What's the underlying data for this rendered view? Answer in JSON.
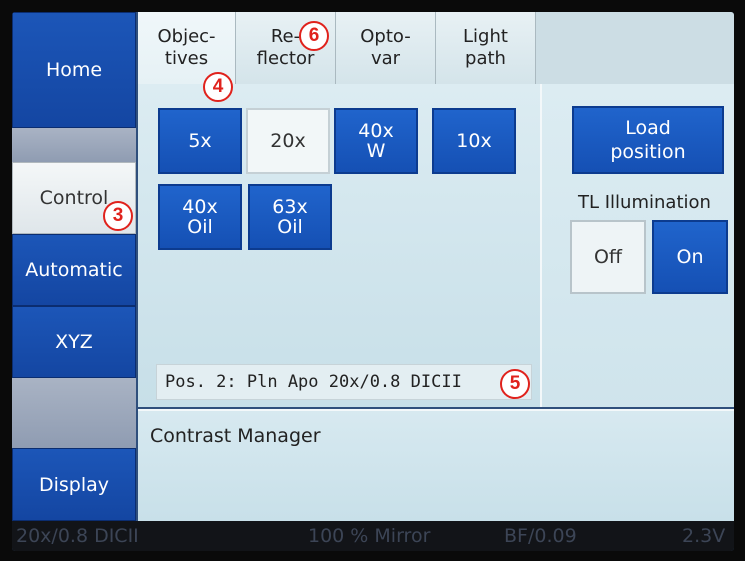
{
  "nav": {
    "home": "Home",
    "control": "Control",
    "automatic": "Automatic",
    "xyz": "XYZ",
    "display": "Display"
  },
  "tabs": {
    "objectives": [
      "Objec-",
      "tives"
    ],
    "reflector": [
      "Re-",
      "flector"
    ],
    "optovar": [
      "Opto-",
      "var"
    ],
    "light_path": [
      "Light",
      "path"
    ]
  },
  "objectives": [
    {
      "line1": "5x",
      "line2": "",
      "selected": false
    },
    {
      "line1": "20x",
      "line2": "",
      "selected": true
    },
    {
      "line1": "40x",
      "line2": "W",
      "selected": false
    },
    {
      "line1": "10x",
      "line2": "",
      "selected": false
    },
    {
      "line1": "40x",
      "line2": "Oil",
      "selected": false
    },
    {
      "line1": "63x",
      "line2": "Oil",
      "selected": false
    }
  ],
  "position_text": "Pos. 2: Pln Apo 20x/0.8 DICII",
  "load_position": [
    "Load",
    "position"
  ],
  "tl_illumination": {
    "label": "TL Illumination",
    "off": "Off",
    "on": "On"
  },
  "contrast_manager": "Contrast Manager",
  "status": {
    "objective": "20x/0.8 DICII",
    "mirror": "100 % Mirror",
    "bf": "BF/0.09",
    "voltage": "2.3V"
  },
  "callouts": {
    "c3": "3",
    "c4": "4",
    "c5": "5",
    "c6": "6"
  },
  "colors": {
    "button_blue": "#1a5cc4",
    "panel_bg": "#d3e7ee",
    "callout_red": "#e0221c"
  }
}
